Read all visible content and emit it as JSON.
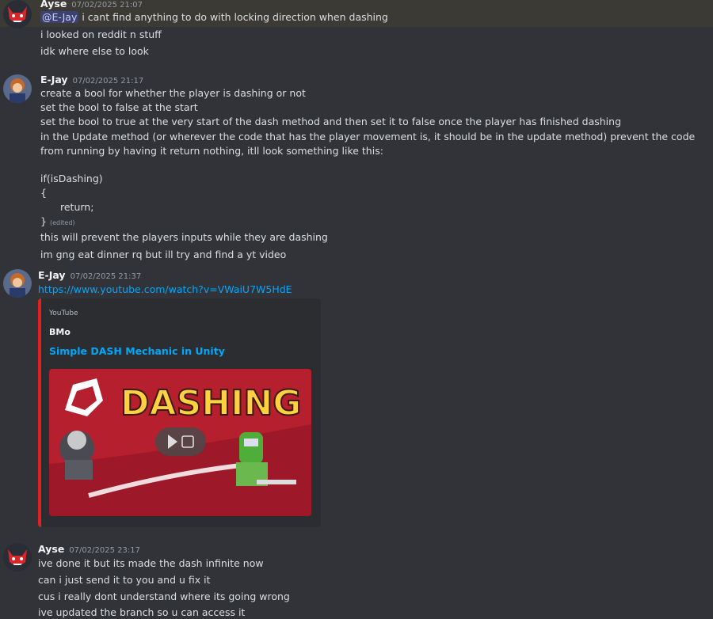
{
  "messages": [
    {
      "username": "Ayse",
      "timestamp": "07/02/2025 21:07",
      "mention": "@E-Jay",
      "lines": [
        " i cant find anything to do with locking direction when dashing",
        "i looked on reddit n stuff",
        "idk where else to look"
      ]
    },
    {
      "username": "E-Jay",
      "timestamp": "07/02/2025 21:17",
      "lines": [
        "create a bool for whether the player is dashing or not",
        "set the bool to false at the start",
        "set the bool to true at the very start of the dash method and then set it to false once the player has finished dashing",
        "in the Update method (or wherever the code that has the player movement is, it should be in the update method) prevent the code from running by having it return nothing, itll look something like this:",
        "if(isDashing)",
        "{",
        "return;",
        "}",
        "this will prevent the players inputs while they are dashing",
        "im gng eat dinner rq but ill try and find a yt video"
      ],
      "edited_label": "(edited)"
    },
    {
      "username": "E-Jay",
      "timestamp": "07/02/2025 21:37",
      "link": "https://www.youtube.com/watch?v=VWaiU7W5HdE",
      "embed": {
        "provider": "YouTube",
        "author": "BMo",
        "title": "Simple DASH Mechanic in Unity",
        "thumbnail_text": "DASHING",
        "accent_color": "#e0211f"
      }
    },
    {
      "username": "Ayse",
      "timestamp": "07/02/2025 23:17",
      "lines": [
        "ive done it but its made the dash infinite now",
        "can i just send it to you and u fix it",
        "cus i really dont understand where its going wrong",
        "ive updated the branch so u can access it"
      ]
    }
  ]
}
